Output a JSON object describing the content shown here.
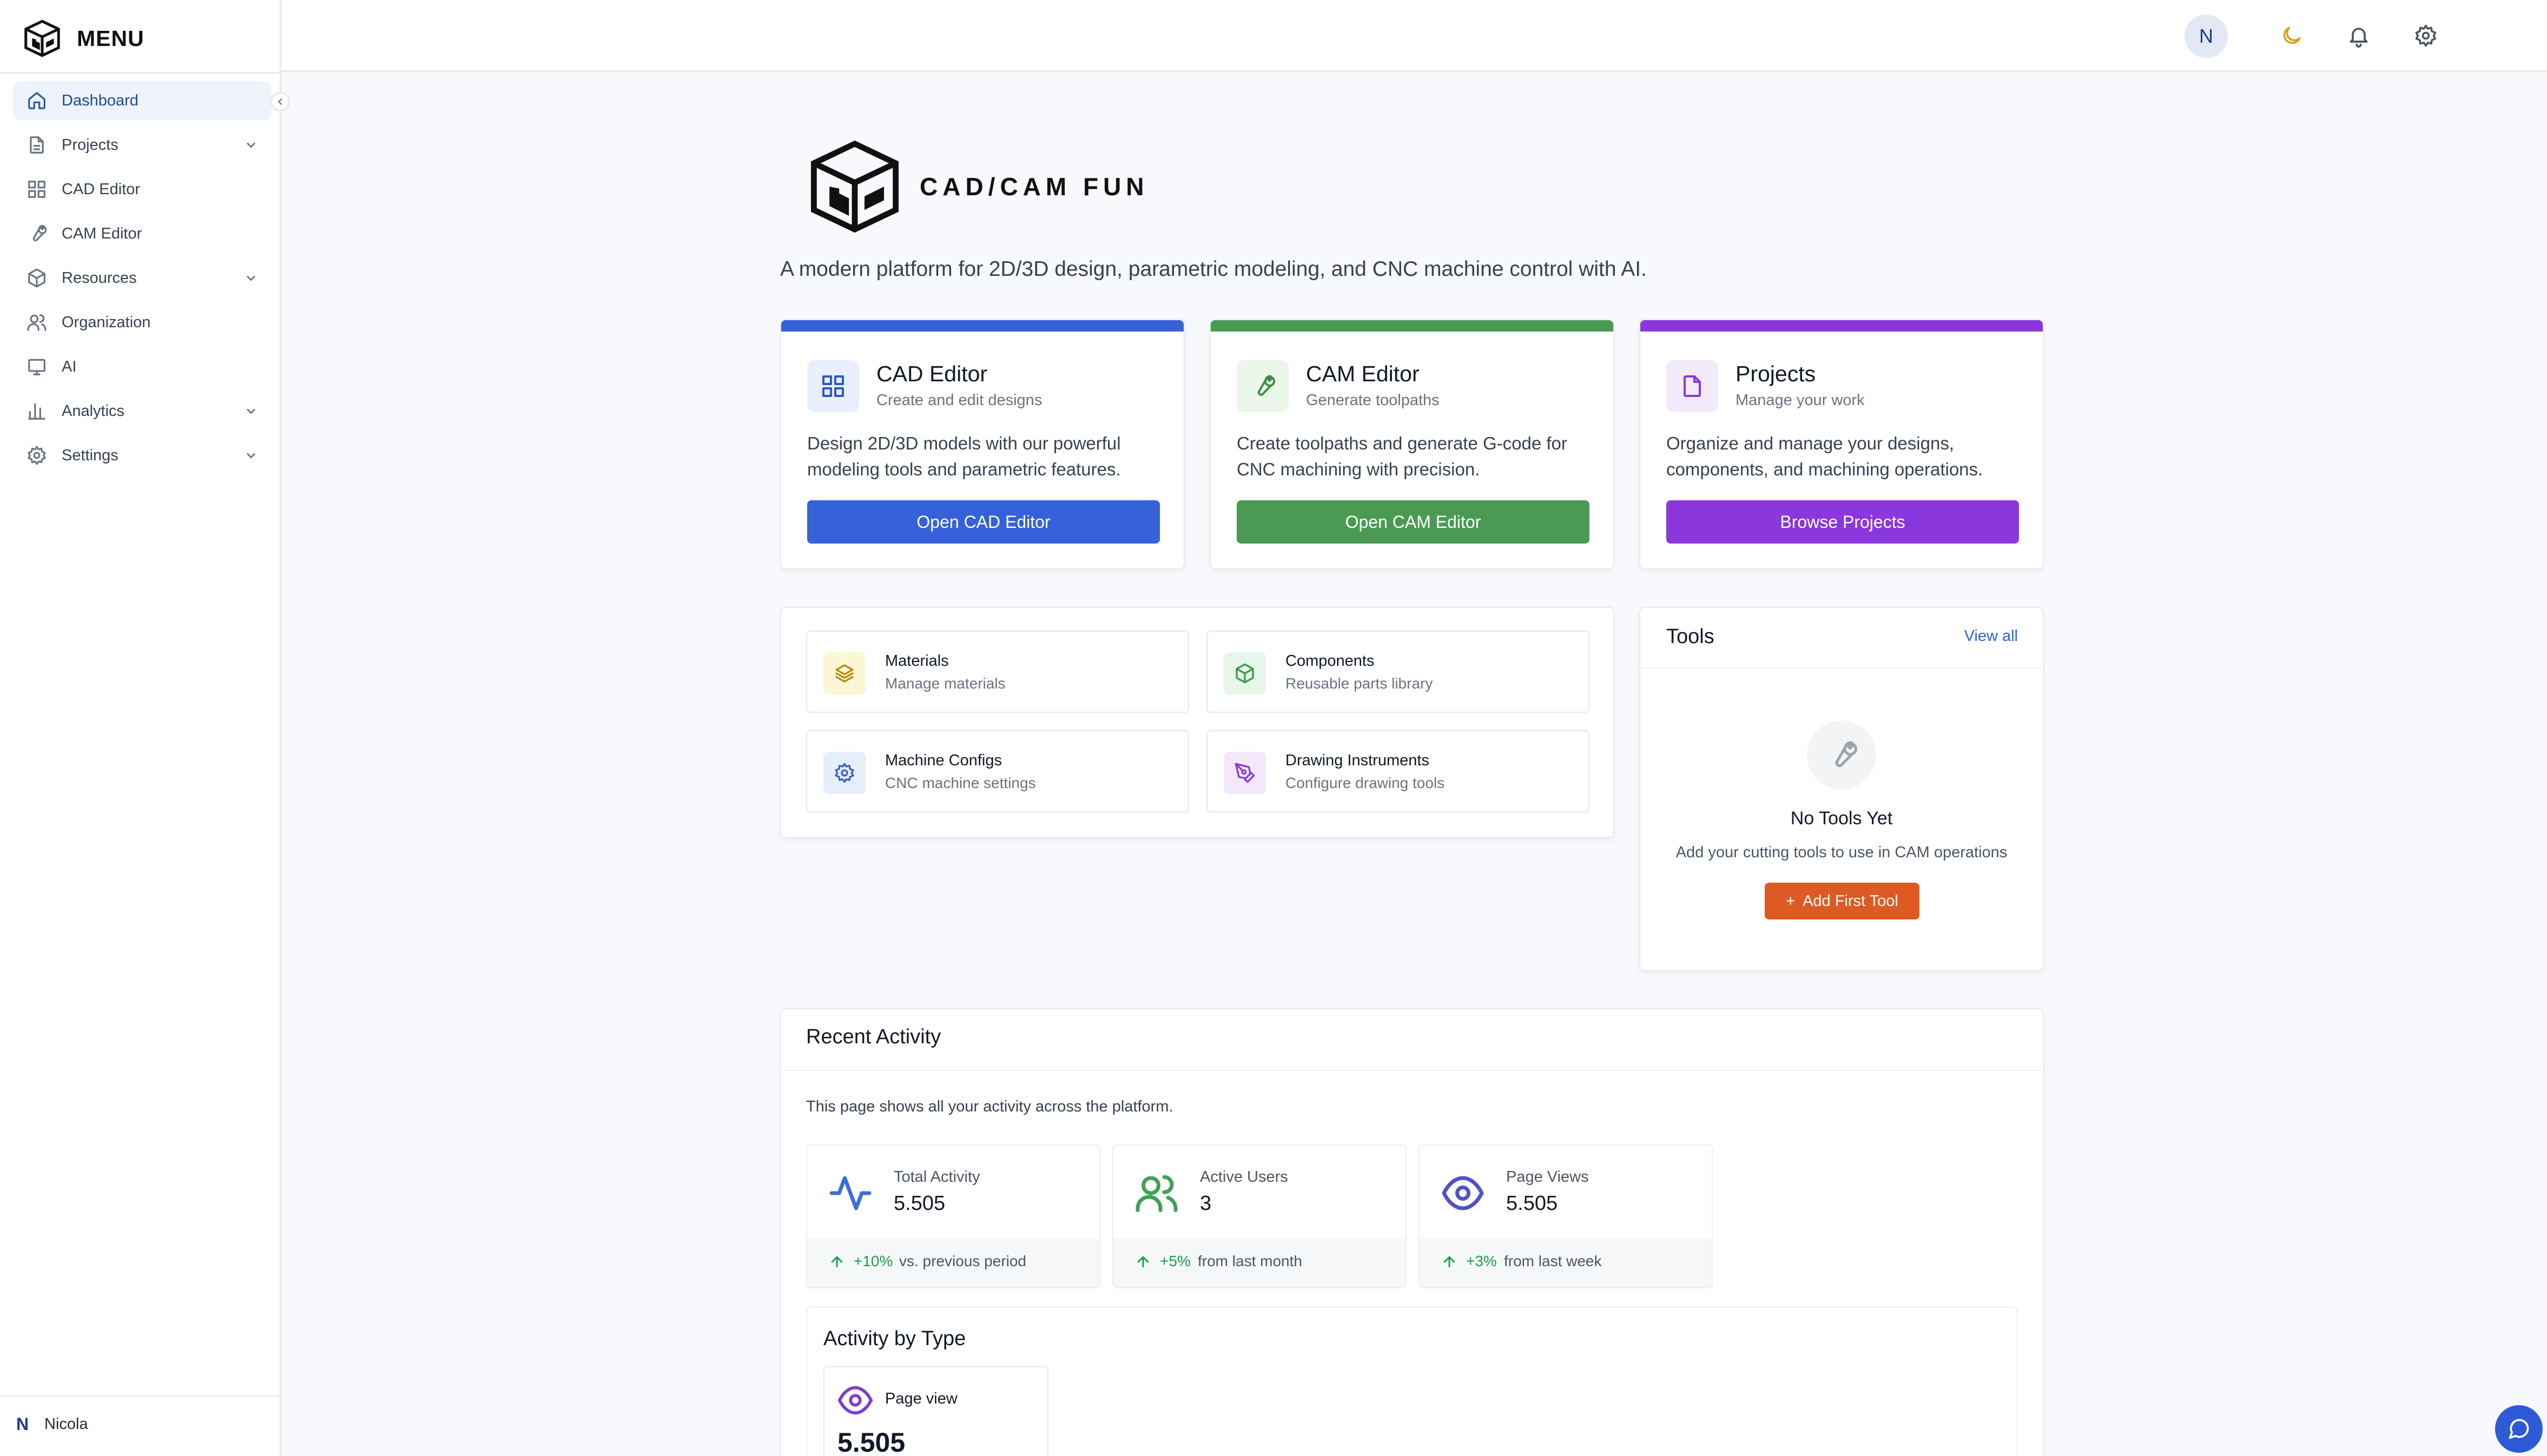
{
  "sidebar": {
    "brand": "MENU",
    "items": [
      {
        "label": "Dashboard",
        "icon": "home-icon",
        "active": true
      },
      {
        "label": "Projects",
        "icon": "file-icon",
        "expandable": true
      },
      {
        "label": "CAD Editor",
        "icon": "grid-icon"
      },
      {
        "label": "CAM Editor",
        "icon": "wrench-icon"
      },
      {
        "label": "Resources",
        "icon": "box-icon",
        "expandable": true
      },
      {
        "label": "Organization",
        "icon": "users-icon"
      },
      {
        "label": "AI",
        "icon": "monitor-icon"
      },
      {
        "label": "Analytics",
        "icon": "bar-chart-icon",
        "expandable": true
      },
      {
        "label": "Settings",
        "icon": "gear-icon",
        "expandable": true
      }
    ],
    "user": {
      "initial": "N",
      "name": "Nicola"
    }
  },
  "topbar": {
    "avatar_initial": "N",
    "icons": [
      "moon-icon",
      "bell-icon",
      "gear-icon"
    ]
  },
  "hero": {
    "logo_text": "CAD/CAM FUN",
    "tagline": "A modern platform for 2D/3D design, parametric modeling, and CNC machine control with AI."
  },
  "features": [
    {
      "title": "CAD Editor",
      "subtitle": "Create and edit designs",
      "description": "Design 2D/3D models with our powerful modeling tools and parametric features.",
      "button": "Open CAD Editor",
      "color": "#3661d9",
      "icon_bg": "#e9effc",
      "icon_color": "#2c58c9"
    },
    {
      "title": "CAM Editor",
      "subtitle": "Generate toolpaths",
      "description": "Create toolpaths and generate G-code for CNC machining with precision.",
      "button": "Open CAM Editor",
      "color": "#4a9a54",
      "icon_bg": "#eaf6ea",
      "icon_color": "#3f8f49"
    },
    {
      "title": "Projects",
      "subtitle": "Manage your work",
      "description": "Organize and manage your designs, components, and machining operations.",
      "button": "Browse Projects",
      "color": "#8a37dd",
      "icon_bg": "#f3eafc",
      "icon_color": "#8a37dd"
    }
  ],
  "quick_links": [
    {
      "title": "Materials",
      "subtitle": "Manage materials",
      "icon": "layers-icon",
      "bg": "#fdf6d5",
      "color": "#b48a12"
    },
    {
      "title": "Components",
      "subtitle": "Reusable parts library",
      "icon": "cube-icon",
      "bg": "#e6f6e8",
      "color": "#3c9a4a"
    },
    {
      "title": "Machine Configs",
      "subtitle": "CNC machine settings",
      "icon": "gear-icon",
      "bg": "#e6eefb",
      "color": "#3763c2"
    },
    {
      "title": "Drawing Instruments",
      "subtitle": "Configure drawing tools",
      "icon": "pen-icon",
      "bg": "#f3e8fb",
      "color": "#8a37dd"
    }
  ],
  "tools": {
    "title": "Tools",
    "view_all": "View all",
    "empty_title": "No Tools Yet",
    "empty_sub": "Add your cutting tools to use in CAM operations",
    "add_button": "Add First Tool"
  },
  "activity": {
    "title": "Recent Activity",
    "description": "This page shows all your activity across the platform.",
    "stats": [
      {
        "label": "Total Activity",
        "value": "5.505",
        "delta": "+10%",
        "comparison": "vs. previous period",
        "icon": "activity-icon",
        "color": "#3b6fd8"
      },
      {
        "label": "Active Users",
        "value": "3",
        "delta": "+5%",
        "comparison": "from last month",
        "icon": "users-icon",
        "color": "#3fa255"
      },
      {
        "label": "Page Views",
        "value": "5.505",
        "delta": "+3%",
        "comparison": "from last week",
        "icon": "eye-icon",
        "color": "#5151c8"
      }
    ],
    "by_type": {
      "title": "Activity by Type",
      "items": [
        {
          "label": "Page view",
          "value": "5.505",
          "icon": "eye-icon"
        }
      ]
    }
  }
}
